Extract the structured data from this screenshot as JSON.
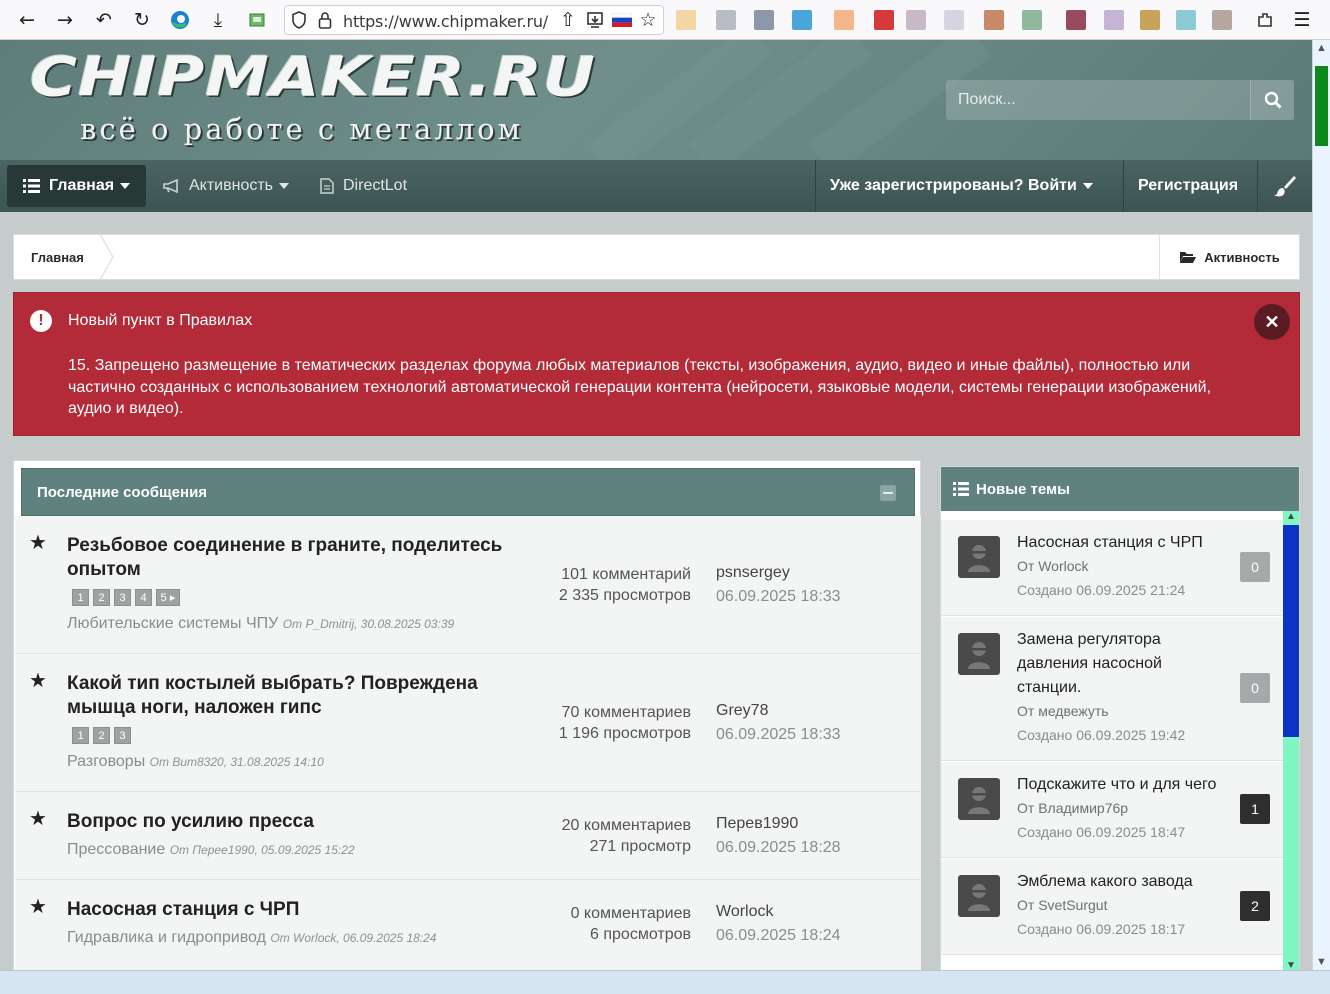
{
  "browser": {
    "url": "https://www.chipmaker.ru/",
    "icons": [
      "back-icon",
      "forward-icon",
      "undo-icon",
      "reload-icon",
      "edge-icon",
      "download-icon",
      "extension-icon",
      "shield-icon",
      "lock-icon",
      "share-icon",
      "install-icon",
      "flag-ru-icon",
      "bookmark-star-icon",
      "extensions-icon",
      "menu-icon"
    ]
  },
  "header": {
    "logo_main": "CHIPMAKER.RU",
    "logo_sub": "всё о работе с металлом",
    "search_placeholder": "Поиск..."
  },
  "nav": {
    "home": "Главная",
    "activity": "Активность",
    "directlot": "DirectLot",
    "login": "Уже зарегистрированы? Войти",
    "register": "Регистрация"
  },
  "breadcrumb": {
    "home": "Главная",
    "activity": "Активность"
  },
  "alert": {
    "title": "Новый пункт в Правилах",
    "body": "15. Запрещено размещение в тематических разделах форума любых материалов (тексты, изображения, аудио, видео и иные файлы), полностью или частично созданных с использованием технологий автоматической генерации контента (нейросети, языковые модели, системы генерации изображений, аудио и видео).",
    "color": "#b32a38"
  },
  "latest": {
    "title": "Последние сообщения",
    "topics": [
      {
        "title": "Резьбовое соединение в граните, поделитесь опытом",
        "pages": [
          "1",
          "2",
          "3",
          "4",
          "5 ▸"
        ],
        "forum": "Любительские системы ЧПУ",
        "by": "От P_Dmitrij, 30.08.2025 03:39",
        "comments": "101 комментарий",
        "views": "2 335 просмотров",
        "last_user": "psnsergey",
        "last_date": "06.09.2025 18:33"
      },
      {
        "title": "Какой тип костылей выбрать? Повреждена мышца ноги, наложен гипс",
        "pages": [
          "1",
          "2",
          "3"
        ],
        "forum": "Разговоры",
        "by": "От Bum8320, 31.08.2025 14:10",
        "comments": "70 комментариев",
        "views": "1 196 просмотров",
        "last_user": "Grey78",
        "last_date": "06.09.2025 18:33"
      },
      {
        "title": "Вопрос по усилию пресса",
        "forum": "Прессование",
        "by": "От Перее1990, 05.09.2025 15:22",
        "comments": "20 комментариев",
        "views": "271 просмотр",
        "last_user": "Перев1990",
        "last_date": "06.09.2025 18:28"
      },
      {
        "title": "Насосная станция с ЧРП",
        "forum": "Гидравлика и гидропривод",
        "by": "От Worlock, 06.09.2025 18:24",
        "comments": "0 комментариев",
        "views": "6 просмотров",
        "last_user": "Worlock",
        "last_date": "06.09.2025 18:24"
      }
    ]
  },
  "new_topics": {
    "title": "Новые темы",
    "items": [
      {
        "title": "Насосная станция с ЧРП",
        "by": "От Worlock",
        "date": "Создано 06.09.2025 21:24",
        "count": "0"
      },
      {
        "title": "Замена регулятора давления насосной станции.",
        "by": "От медвежуть",
        "date": "Создано 06.09.2025 19:42",
        "count": "0"
      },
      {
        "title": "Подскажите что и для чего",
        "by": "От Владимир76р",
        "date": "Создано 06.09.2025 18:47",
        "count": "1"
      },
      {
        "title": "Эмблема какого завода",
        "by": "От SvetSurgut",
        "date": "Создано 06.09.2025 18:17",
        "count": "2"
      }
    ]
  }
}
